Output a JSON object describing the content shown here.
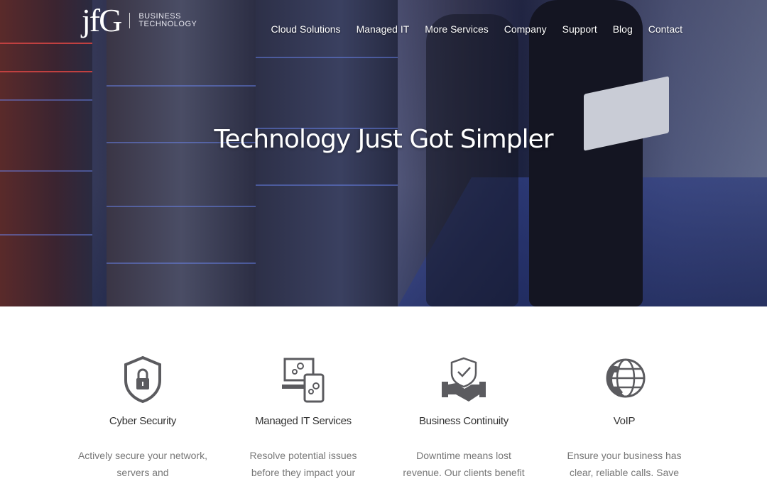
{
  "brand": {
    "logo_mark": "jfG",
    "logo_line1": "BUSINESS",
    "logo_line2": "TECHNOLOGY"
  },
  "nav": {
    "items": [
      "Cloud Solutions",
      "Managed IT",
      "More Services",
      "Company",
      "Support",
      "Blog",
      "Contact"
    ]
  },
  "hero": {
    "title": "Technology Just Got Simpler"
  },
  "services": [
    {
      "icon": "shield-lock-icon",
      "title": "Cyber Security",
      "desc": "Actively secure your network, servers and"
    },
    {
      "icon": "devices-gears-icon",
      "title": "Managed IT Services",
      "desc": "Resolve potential issues before they impact your"
    },
    {
      "icon": "shield-handshake-icon",
      "title": "Business Continuity",
      "desc": "Downtime means lost revenue.  Our clients benefit"
    },
    {
      "icon": "phone-globe-icon",
      "title": "VoIP",
      "desc": "Ensure your business has clear, reliable calls. Save"
    }
  ],
  "colors": {
    "icon": "#5b5b5f",
    "title_text": "#333333",
    "desc_text": "#777777"
  }
}
